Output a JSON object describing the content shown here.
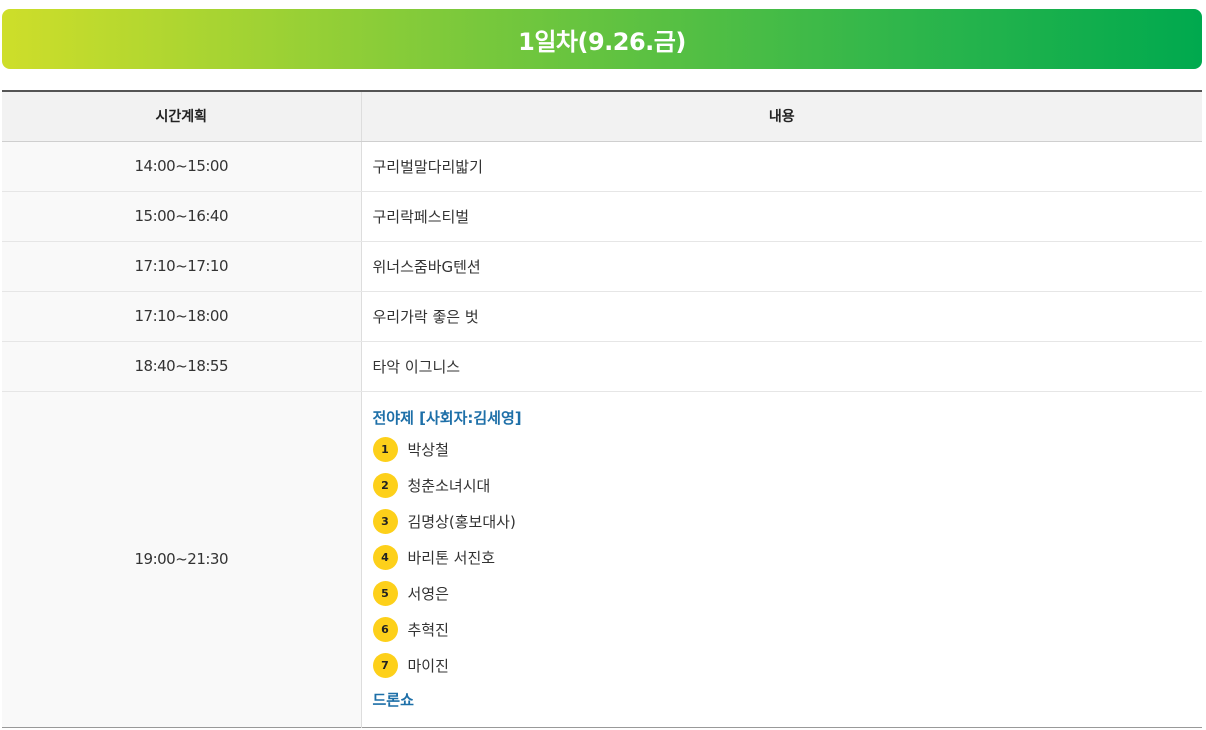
{
  "banner": {
    "title": "1일차(9.26.금)",
    "gradient_start": "#cede2a",
    "gradient_end": "#00a94e"
  },
  "table": {
    "headers": {
      "time": "시간계획",
      "content": "내용"
    },
    "rows": [
      {
        "time": "14:00~15:00",
        "content": "구리벌말다리밟기"
      },
      {
        "time": "15:00~16:40",
        "content": "구리락페스티벌"
      },
      {
        "time": "17:10~17:10",
        "content": "위너스줌바G텐션"
      },
      {
        "time": "17:10~18:00",
        "content": "우리가락 좋은 벗"
      },
      {
        "time": "18:40~18:55",
        "content": "타악 이그니스"
      }
    ],
    "big_row": {
      "time": "19:00~21:30",
      "section_title": "전야제 [사회자:김세영]",
      "performers": [
        {
          "num": "1",
          "name": "박상철"
        },
        {
          "num": "2",
          "name": "청춘소녀시대"
        },
        {
          "num": "3",
          "name": "김명상(홍보대사)"
        },
        {
          "num": "4",
          "name": "바리톤 서진호"
        },
        {
          "num": "5",
          "name": "서영은"
        },
        {
          "num": "6",
          "name": "추혁진"
        },
        {
          "num": "7",
          "name": "마이진"
        }
      ],
      "closing": "드론쇼"
    }
  },
  "colors": {
    "accent": "#1d6fa8",
    "badge": "#fdd01a",
    "header_bg": "#f2f2f2"
  }
}
